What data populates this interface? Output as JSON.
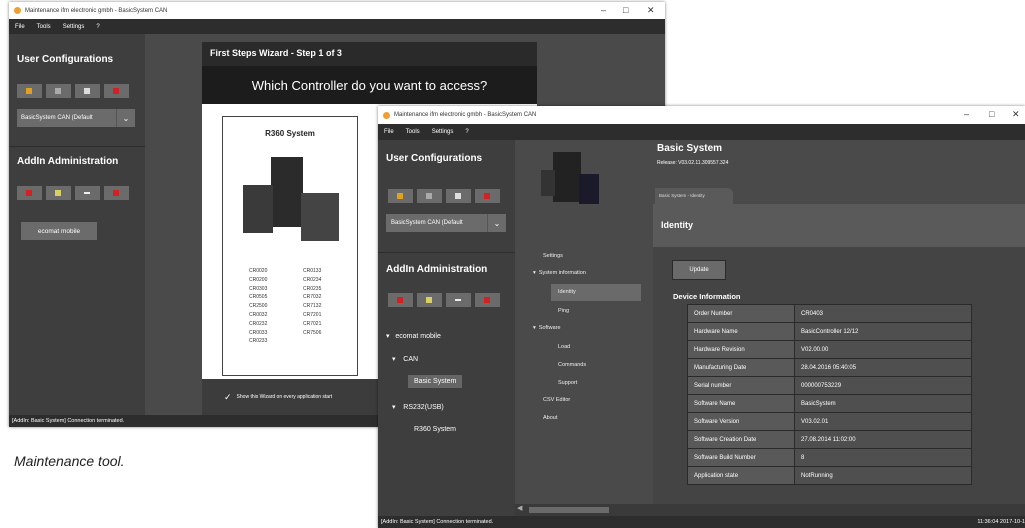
{
  "caption": "Maintenance tool.",
  "back_window": {
    "title": "Maintenance ifm electronic gmbh - BasicSystem CAN",
    "menu": [
      "File",
      "Tools",
      "Settings",
      "?"
    ],
    "user_config_heading": "User Configurations",
    "config_select": "BasicSystem CAN (Default",
    "addin_heading": "AddIn Administration",
    "ecomat_button": "ecomat mobile",
    "wizard": {
      "title": "First Steps Wizard - Step 1 of 3",
      "question": "Which Controller do you want to access?",
      "card_title": "R360 System",
      "codes_left": [
        "CR0020",
        "CR0200",
        "CR0303",
        "CR0505",
        "CR2500",
        "CR0032",
        "CR0232",
        "CR0033",
        "CR0233"
      ],
      "codes_right": [
        "CR0133",
        "CR0234",
        "CR0235",
        "CR7032",
        "CR7132",
        "CR7201",
        "CR7021",
        "CR7506"
      ],
      "show_wizard_label": "Show this Wizard on every application start"
    },
    "status": "[AddIn: Basic System] Connection terminated."
  },
  "front_window": {
    "title": "Maintenance ifm electronic gmbh - BasicSystem CAN",
    "menu": [
      "File",
      "Tools",
      "Settings",
      "?"
    ],
    "user_config_heading": "User Configurations",
    "config_select": "BasicSystem CAN (Default",
    "addin_heading": "AddIn Administration",
    "tree": {
      "ecomat": "ecomat mobile",
      "can": "CAN",
      "basic_system": "Basic System",
      "rs232": "RS232(USB)",
      "r360": "R360 System"
    },
    "header": {
      "title": "Basic System",
      "release": "Release: V03.02.11.309557.324",
      "tab": "Basic System - Identity"
    },
    "nav": {
      "settings": "Settings",
      "system_information": "System information",
      "identity": "Identity",
      "ping": "Ping",
      "software": "Software",
      "load": "Load",
      "commands": "Commands",
      "support": "Support",
      "csv_editor": "CSV Editor",
      "about": "About"
    },
    "identity_heading": "Identity",
    "update_button": "Update",
    "device_info_heading": "Device Information",
    "device_info": [
      {
        "key": "Order Number",
        "value": "CR0403"
      },
      {
        "key": "Hardware Name",
        "value": "BasicController 12/12"
      },
      {
        "key": "Hardware Revision",
        "value": "V02.00.00"
      },
      {
        "key": "Manufacturing Date",
        "value": "28.04.2016 05:40:05"
      },
      {
        "key": "Serial number",
        "value": "000000753229"
      },
      {
        "key": "Software Name",
        "value": "BasicSystem"
      },
      {
        "key": "Software Version",
        "value": "V03.02.01"
      },
      {
        "key": "Software Creation Date",
        "value": "27.08.2014 11:02:00"
      },
      {
        "key": "Software Build Number",
        "value": "8"
      },
      {
        "key": "Application state",
        "value": "NotRunning"
      }
    ],
    "status_left": "[AddIn: Basic System] Connection terminated.",
    "status_right": "11:36:04  2017-10-1"
  }
}
